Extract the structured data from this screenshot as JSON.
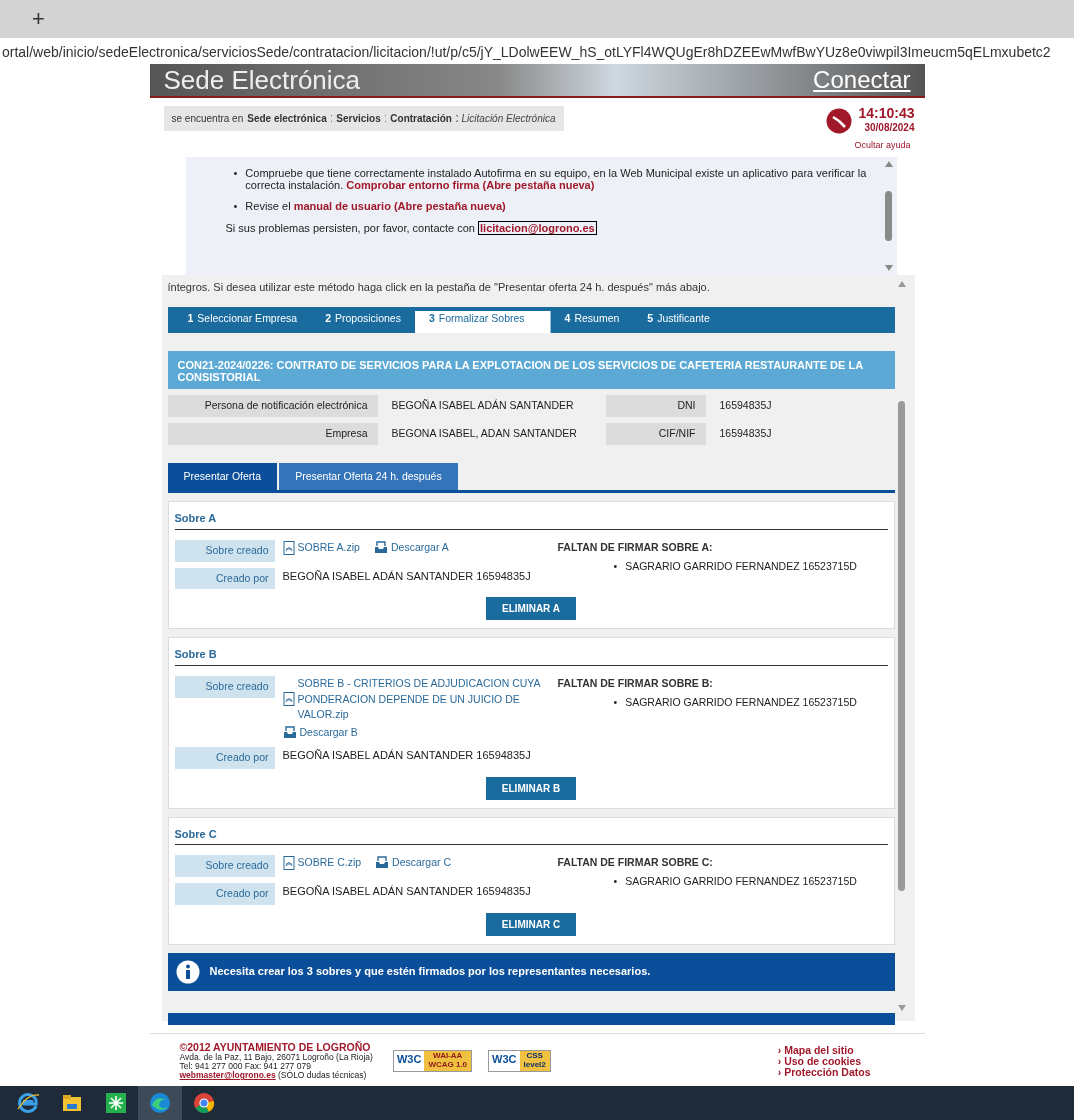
{
  "browser": {
    "new_tab": "+",
    "url": "ortal/web/inicio/sedeElectronica/serviciosSede/contratacion/licitacion/!ut/p/c5/jY_LDolwEEW_hS_otLYFl4WQUgEr8hDZEEwMwfBwYUz8e0viwpil3Imeucm5qELmxubetc2"
  },
  "header": {
    "title": "Sede Electrónica",
    "connect": "Conectar"
  },
  "breadcrumb": {
    "prefix": "se encuentra en",
    "items": [
      {
        "label": "Sede electrónica",
        "current": false
      },
      {
        "label": "Servicios",
        "current": false
      },
      {
        "label": "Contratación",
        "current": false
      },
      {
        "label": "Licitación Electrónica",
        "current": true
      }
    ]
  },
  "clock": {
    "time": "14:10:43",
    "date": "30/08/2024"
  },
  "help": {
    "toggle": "Ocultar ayuda",
    "bullets": [
      {
        "marker": "•",
        "text": "Compruebe que tiene correctamente instalado Autofirma en su equipo, en la Web Municipal existe un aplicativo para verificar la correcta instalación.",
        "link": "Comprobar entorno firma (Abre pestaña nueva)"
      },
      {
        "marker": "•",
        "text": "Revise el",
        "link": "manual de usuario (Abre pestaña nueva)"
      }
    ],
    "contact": "Si sus problemas persisten, por favor, contacte con",
    "email": "licitacion@logrono.es"
  },
  "notice": "íntegros. Si desea utilizar este método haga click en la pestaña de \"Presentar oferta 24 h. después\" más abajo.",
  "steps": [
    {
      "number": "1",
      "label": "Seleccionar Empresa",
      "selected": false
    },
    {
      "number": "2",
      "label": "Proposiciones",
      "selected": false
    },
    {
      "number": "3",
      "label": "Formalizar Sobres",
      "selected": true
    },
    {
      "number": "4",
      "label": "Resumen",
      "selected": false
    },
    {
      "number": "5",
      "label": "Justificante",
      "selected": false
    }
  ],
  "contract_title": "CON21-2024/0226: CONTRATO DE SERVICIOS PARA LA EXPLOTACION DE LOS SERVICIOS DE CAFETERIA RESTAURANTE DE LA CONSISTORIAL",
  "details": [
    {
      "label": "Persona de notificación electrónica",
      "value": "BEGOÑA ISABEL ADÁN SANTANDER",
      "id_label": "DNI",
      "id_value": "16594835J"
    },
    {
      "label": "Empresa",
      "value": "BEGONA ISABEL, ADAN SANTANDER",
      "id_label": "CIF/NIF",
      "id_value": "16594835J"
    }
  ],
  "offer_tabs": [
    {
      "label": "Presentar Oferta",
      "selected": true
    },
    {
      "label": "Presentar Oferta 24 h. después",
      "selected": false
    }
  ],
  "sobres": [
    {
      "title": "Sobre A",
      "created_label": "Sobre creado",
      "file": "SOBRE A.zip",
      "download": "Descargar A",
      "author_label": "Creado por",
      "author": "BEGOÑA ISABEL ADÁN SANTANDER 16594835J",
      "pending_title": "FALTAN DE FIRMAR SOBRE A:",
      "pending": [
        {
          "marker": "•",
          "name": "SAGRARIO GARRIDO FERNANDEZ 16523715D"
        }
      ],
      "delete": "ELIMINAR A"
    },
    {
      "title": "Sobre B",
      "created_label": "Sobre creado",
      "file": "SOBRE B - CRITERIOS DE ADJUDICACION CUYA PONDERACION DEPENDE DE UN JUICIO DE VALOR.zip",
      "download": "Descargar B",
      "author_label": "Creado por",
      "author": "BEGOÑA ISABEL ADÁN SANTANDER 16594835J",
      "pending_title": "FALTAN DE FIRMAR SOBRE B:",
      "pending": [
        {
          "marker": "•",
          "name": "SAGRARIO GARRIDO FERNANDEZ 16523715D"
        }
      ],
      "delete": "ELIMINAR B"
    },
    {
      "title": "Sobre C",
      "created_label": "Sobre creado",
      "file": "SOBRE C.zip",
      "download": "Descargar C",
      "author_label": "Creado por",
      "author": "BEGOÑA ISABEL ADÁN SANTANDER 16594835J",
      "pending_title": "FALTAN DE FIRMAR SOBRE C:",
      "pending": [
        {
          "marker": "•",
          "name": "SAGRARIO GARRIDO FERNANDEZ 16523715D"
        }
      ],
      "delete": "ELIMINAR C"
    }
  ],
  "info": "Necesita crear los 3 sobres y que estén firmados por los representantes necesarios.",
  "footer": {
    "org": "©2012 AYUNTAMIENTO DE LOGROÑO",
    "address": "Avda. de la Paz, 11 Bajo, 26071 Logroño (La Rioja)",
    "phone": "Tel: 941 277 000 Fax: 941 277 079",
    "email": "webmaster@logrono.es",
    "email_note": "(SÓLO dudas técnicas)",
    "badges": [
      {
        "kind": "wai",
        "logo": "W3C",
        "line1": "WAI-AA",
        "line2": "WCAG 1.0"
      },
      {
        "kind": "css",
        "logo": "W3C",
        "line1": "CSS",
        "line2": "level2"
      }
    ],
    "links": [
      "› Mapa del sitio",
      "› Uso de cookies",
      "› Protección Datos"
    ]
  },
  "taskbar": [
    {
      "kind": "ie",
      "selected": false
    },
    {
      "kind": "folder",
      "selected": false
    },
    {
      "kind": "asterisk",
      "selected": false
    },
    {
      "kind": "edge",
      "selected": true
    },
    {
      "kind": "chrome",
      "selected": false
    }
  ]
}
